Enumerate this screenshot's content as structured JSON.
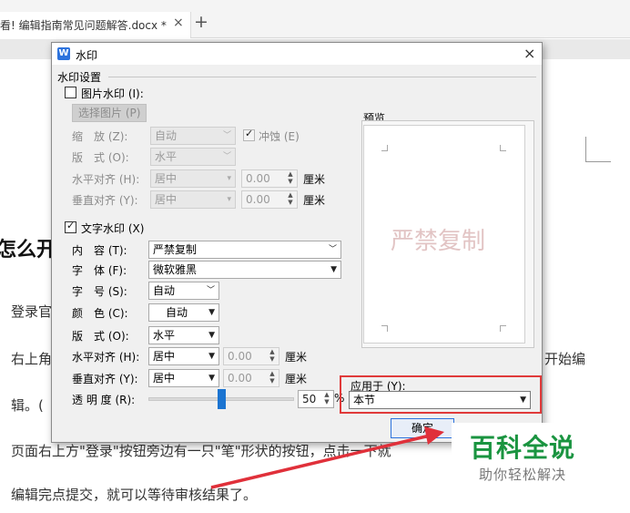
{
  "tab": {
    "title": "看! 编辑指南常见问题解答.docx *",
    "close": "×",
    "add": "+"
  },
  "document": {
    "heading": "怎么开",
    "lines": [
      "登录官",
      "右上角",
      "开始编",
      "辑。(",
      "页面右上方\"登录\"按钮旁边有一只\"笔\"形状的按钮，点击一下就",
      "编辑完点提交，就可以等待审核结果了。"
    ]
  },
  "dialog": {
    "title": "水印",
    "close": "×",
    "app_icon": "W",
    "group_label": "水印设置",
    "picture": {
      "checkbox_label": "图片水印 (I):",
      "checked": false,
      "select_button": "选择图片 (P)",
      "scale_label": "缩　放 (Z):",
      "scale_value": "自动",
      "washout_label": "冲蚀 (E)",
      "layout_label": "版　式 (O):",
      "layout_value": "水平",
      "halign_label": "水平对齐 (H):",
      "halign_value": "居中",
      "halign_num": "0.00",
      "valign_label": "垂直对齐 (Y):",
      "valign_value": "居中",
      "valign_num": "0.00",
      "unit": "厘米"
    },
    "text": {
      "checkbox_label": "文字水印 (X)",
      "checked": true,
      "content_label": "内　容 (T):",
      "content_value": "严禁复制",
      "font_label": "字　体 (F):",
      "font_value": "微软雅黑",
      "size_label": "字　号 (S):",
      "size_value": "自动",
      "color_label": "颜　色 (C):",
      "color_value": "自动",
      "layout_label": "版　式 (O):",
      "layout_value": "水平",
      "halign_label": "水平对齐 (H):",
      "halign_value": "居中",
      "halign_num": "0.00",
      "valign_label": "垂直对齐 (Y):",
      "valign_value": "居中",
      "valign_num": "0.00",
      "unit": "厘米",
      "transparency_label": "透 明 度 (R):",
      "transparency_value": "50",
      "transparency_unit": "%",
      "transparency_percent": 50
    },
    "preview": {
      "label": "预览",
      "watermark": "严禁复制"
    },
    "apply": {
      "label": "应用于 (Y):",
      "value": "本节"
    },
    "ok_button": "确定"
  },
  "brand": {
    "main": "百科全说",
    "sub": "助你轻松解决"
  },
  "colors": {
    "accent": "#2d73dd",
    "highlight": "#e03a3a",
    "brand_green": "#1a9440",
    "watermark_preview": "#e2c4c4"
  }
}
